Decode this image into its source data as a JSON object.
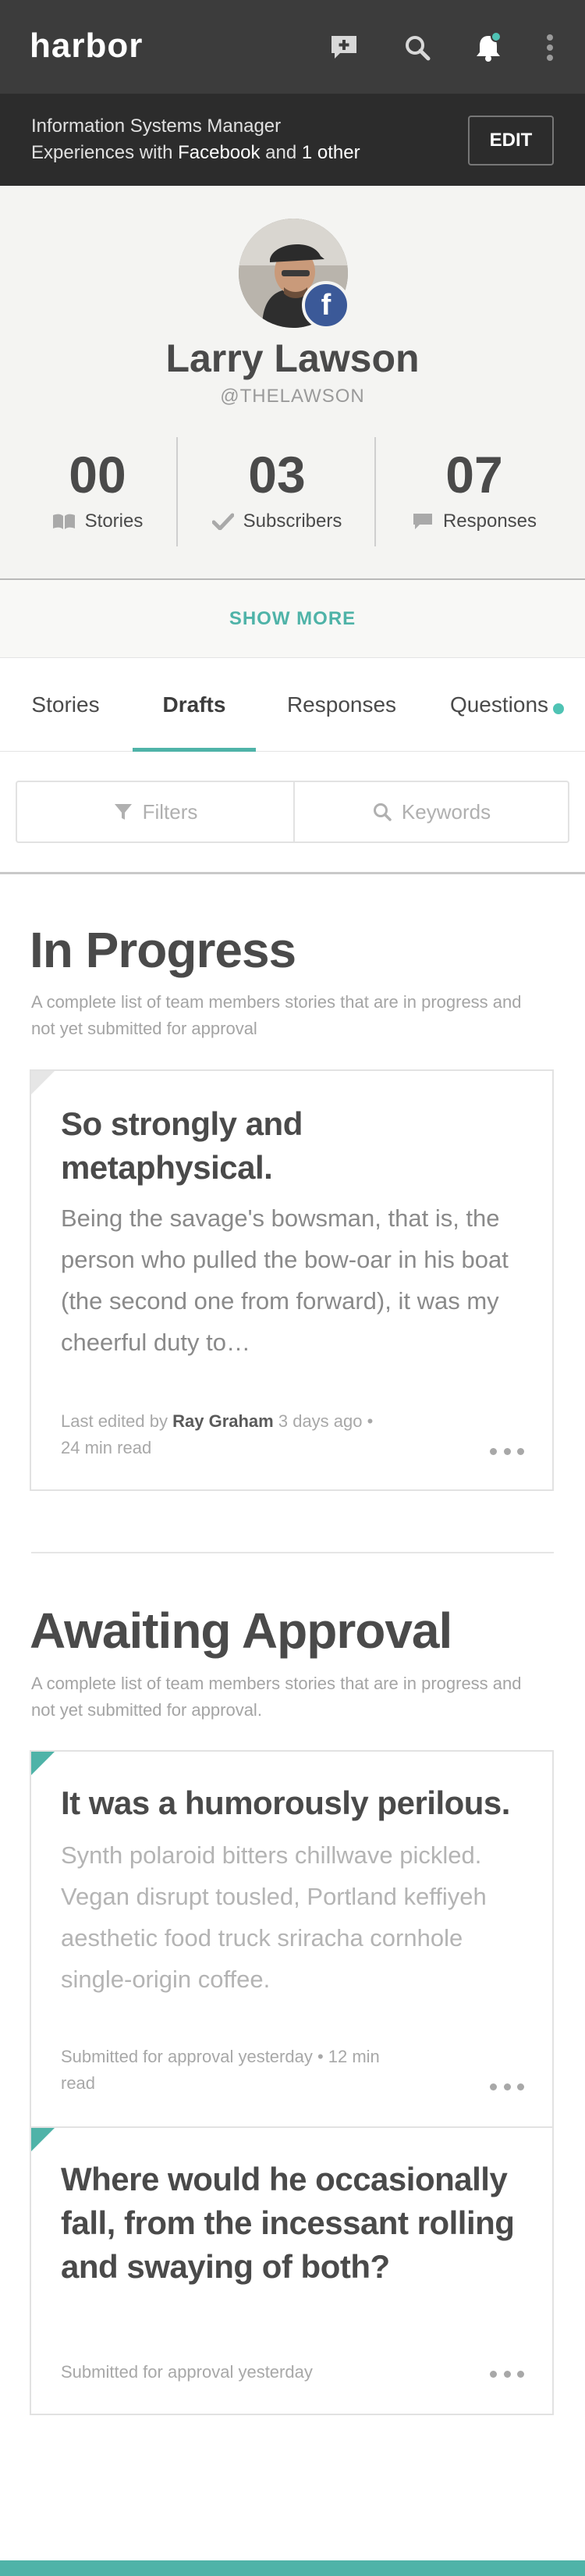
{
  "header": {
    "logo": "harbor",
    "icons": [
      "compose-icon",
      "search-icon",
      "bell-icon",
      "more-vertical-icon"
    ],
    "notification_dot_color": "#4fc3b4"
  },
  "info": {
    "job_title": "Information Systems Manager",
    "experience_prefix": "Experiences with",
    "experience_platform": "Facebook",
    "experience_and": "and",
    "experience_other": "1 other",
    "edit_label": "EDIT"
  },
  "profile": {
    "name": "Larry Lawson",
    "handle": "@THELAWSON",
    "badge": "f",
    "stats": [
      {
        "value": "00",
        "label": "Stories",
        "icon": "book-icon"
      },
      {
        "value": "03",
        "label": "Subscribers",
        "icon": "check-icon"
      },
      {
        "value": "07",
        "label": "Responses",
        "icon": "comment-icon"
      }
    ],
    "show_more": "SHOW MORE"
  },
  "tabs": {
    "items": [
      "Stories",
      "Drafts",
      "Responses",
      "Questions"
    ],
    "active": "Drafts",
    "accent": "#4fb3a8"
  },
  "filters": {
    "filters_label": "Filters",
    "keywords_label": "Keywords"
  },
  "in_progress": {
    "title": "In Progress",
    "description": "A complete list of team members stories that are in progress and not yet submitted for approval",
    "cards": [
      {
        "title": "So strongly and metaphysical.",
        "body": "Being the savage's bowsman, that is, the person who pulled the bow-oar in his boat (the second one from forward), it was my cheerful duty to…",
        "meta_prefix": "Last edited by",
        "meta_author": "Ray Graham",
        "meta_suffix": "3 days ago  •  24 min read"
      }
    ]
  },
  "awaiting": {
    "title": "Awaiting Approval",
    "description": "A complete list of team members stories that are in progress and not yet submitted for approval.",
    "cards": [
      {
        "title": "It was a humorously perilous.",
        "body": "Synth polaroid bitters chillwave pickled. Vegan disrupt tousled, Portland keffiyeh aesthetic food truck sriracha cornhole single-origin coffee.",
        "meta": "Submitted for approval yesterday  •  12 min read"
      },
      {
        "title": "Where would he occasionally fall, from the incessant rolling and swaying of both?",
        "meta": "Submitted for approval yesterday"
      }
    ]
  }
}
